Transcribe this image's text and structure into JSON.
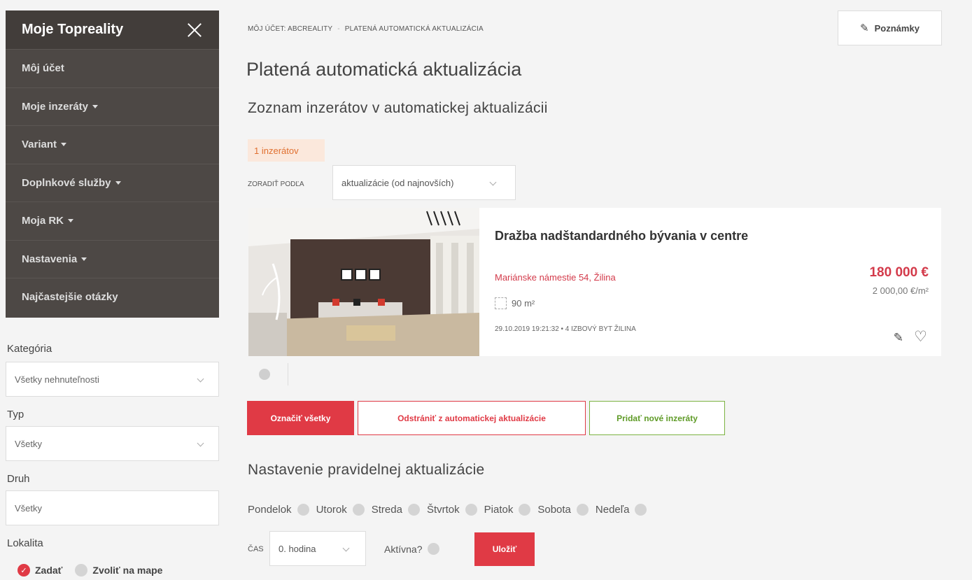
{
  "sidebar": {
    "title": "Moje Topreality",
    "items": [
      {
        "label": "Môj účet",
        "has_caret": false
      },
      {
        "label": "Moje inzeráty",
        "has_caret": true
      },
      {
        "label": "Variant",
        "has_caret": true
      },
      {
        "label": "Doplnkové služby",
        "has_caret": true
      },
      {
        "label": "Moja RK",
        "has_caret": true
      },
      {
        "label": "Nastavenia",
        "has_caret": true
      },
      {
        "label": "Najčastejšie otázky",
        "has_caret": false
      }
    ]
  },
  "filters": {
    "category_label": "Kategória",
    "category_value": "Všetky nehnuteľnosti",
    "type_label": "Typ",
    "type_value": "Všetky",
    "kind_label": "Druh",
    "kind_value": "Všetky",
    "location_label": "Lokalita",
    "location_option_enter": "Zadať",
    "location_option_map": "Zvoliť na mape"
  },
  "breadcrumb": {
    "item1": "MÔJ ÚČET: ABCREALITY",
    "separator": "-",
    "item2": "PLATENÁ AUTOMATICKÁ AKTUALIZÁCIA"
  },
  "notes_button": "Poznámky",
  "page_title": "Platená automatická aktualizácia",
  "list_title": "Zoznam inzerátov v automatickej aktualizácii",
  "count_badge": "1 inzerátov",
  "sort": {
    "label": "ZORADIŤ PODĽA",
    "value": "aktualizácie (od najnovších)"
  },
  "listing": {
    "title": "Dražba nadštandardného bývania v centre",
    "address": "Mariánske námestie 54, Žilina",
    "area": "90 m²",
    "meta": "29.10.2019 19:21:32  •  4 IZBOVÝ BYT ŽILINA",
    "price": "180 000 €",
    "price_per_m2": "2 000,00 €/m²"
  },
  "actions": {
    "select_all": "Označiť všetky",
    "remove": "Odstrániť z automatickej aktualizácie",
    "add_new": "Pridať nové inzeráty"
  },
  "schedule": {
    "title": "Nastavenie pravidelnej aktualizácie",
    "days": [
      "Pondelok",
      "Utorok",
      "Streda",
      "Štvrtok",
      "Piatok",
      "Sobota",
      "Nedeľa"
    ],
    "time_label": "ČAS",
    "time_value": "0. hodina",
    "active_label": "Aktívna?",
    "save": "Uložiť"
  },
  "colors": {
    "accent_red": "#e03a45",
    "sidebar_bg": "#4d4845",
    "green": "#7cb342"
  }
}
